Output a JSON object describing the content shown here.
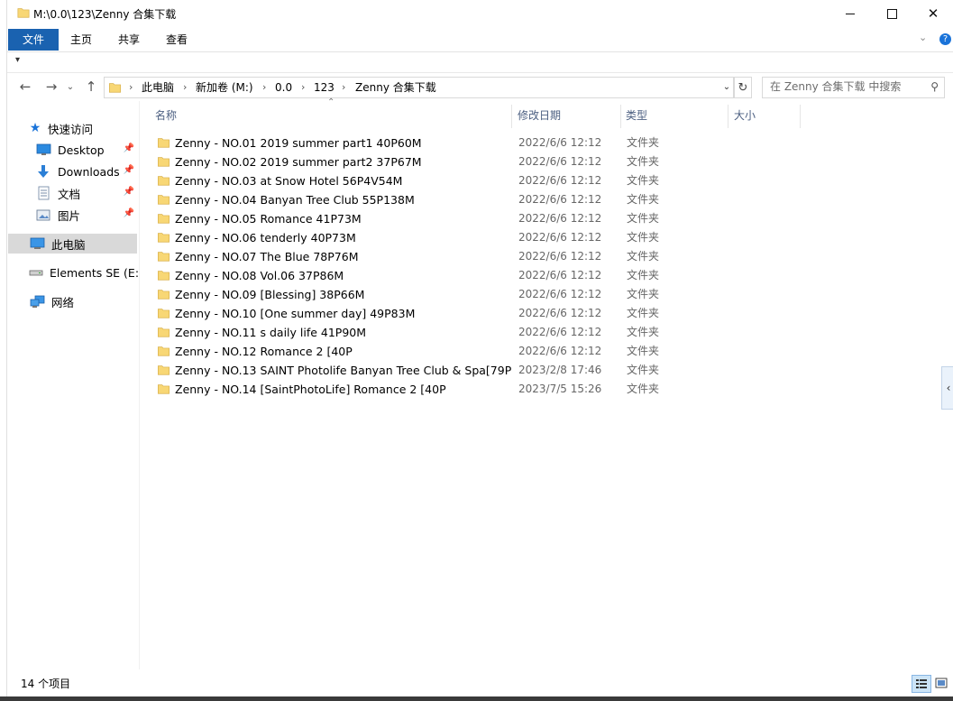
{
  "window": {
    "title": "M:\\0.0\\123\\Zenny 合集下载",
    "minimize_icon": "minimize-icon",
    "maximize_icon": "maximize-icon",
    "close_icon": "close-icon"
  },
  "ribbon": {
    "tabs": [
      "文件",
      "主页",
      "共享",
      "查看"
    ],
    "collapse_icon": "chevron-down-icon",
    "help_icon": "help-icon"
  },
  "address": {
    "crumbs": [
      "此电脑",
      "新加卷 (M:)",
      "0.0",
      "123",
      "Zenny 合集下载"
    ],
    "separator": "›"
  },
  "search": {
    "placeholder": "在 Zenny 合集下载 中搜索"
  },
  "sidebar": {
    "quick_access": "快速访问",
    "items": [
      {
        "label": "Desktop",
        "icon": "desktop-icon",
        "pinned": true
      },
      {
        "label": "Downloads",
        "icon": "download-icon",
        "pinned": true
      },
      {
        "label": "文档",
        "icon": "document-icon",
        "pinned": true
      },
      {
        "label": "图片",
        "icon": "picture-icon",
        "pinned": true
      }
    ],
    "this_pc": "此电脑",
    "drive": "Elements SE (E:)",
    "network": "网络"
  },
  "columns": {
    "name": "名称",
    "modified": "修改日期",
    "type": "类型",
    "size": "大小"
  },
  "files": [
    {
      "name": "Zenny - NO.01 2019 summer part1 40P60M",
      "date": "2022/6/6 12:12",
      "type": "文件夹"
    },
    {
      "name": "Zenny - NO.02 2019 summer part2 37P67M",
      "date": "2022/6/6 12:12",
      "type": "文件夹"
    },
    {
      "name": "Zenny - NO.03 at Snow Hotel 56P4V54M",
      "date": "2022/6/6 12:12",
      "type": "文件夹"
    },
    {
      "name": "Zenny - NO.04 Banyan Tree Club 55P138M",
      "date": "2022/6/6 12:12",
      "type": "文件夹"
    },
    {
      "name": "Zenny - NO.05 Romance 41P73M",
      "date": "2022/6/6 12:12",
      "type": "文件夹"
    },
    {
      "name": "Zenny - NO.06 tenderly 40P73M",
      "date": "2022/6/6 12:12",
      "type": "文件夹"
    },
    {
      "name": "Zenny - NO.07 The Blue 78P76M",
      "date": "2022/6/6 12:12",
      "type": "文件夹"
    },
    {
      "name": "Zenny - NO.08 Vol.06 37P86M",
      "date": "2022/6/6 12:12",
      "type": "文件夹"
    },
    {
      "name": "Zenny - NO.09 [Blessing] 38P66M",
      "date": "2022/6/6 12:12",
      "type": "文件夹"
    },
    {
      "name": "Zenny - NO.10 [One summer day] 49P83M",
      "date": "2022/6/6 12:12",
      "type": "文件夹"
    },
    {
      "name": "Zenny - NO.11 s daily life 41P90M",
      "date": "2022/6/6 12:12",
      "type": "文件夹"
    },
    {
      "name": "Zenny - NO.12 Romance 2 [40P",
      "date": "2022/6/6 12:12",
      "type": "文件夹"
    },
    {
      "name": "Zenny - NO.13 SAINT Photolife Banyan Tree Club & Spa[79P",
      "date": "2023/2/8 17:46",
      "type": "文件夹"
    },
    {
      "name": "Zenny - NO.14 [SaintPhotoLife] Romance 2 [40P",
      "date": "2023/7/5 15:26",
      "type": "文件夹"
    }
  ],
  "status": {
    "item_count": "14 个项目"
  },
  "colors": {
    "accent": "#1a62b0",
    "folder": "#f8d775",
    "selected_bg": "#d9d9d9",
    "column_header": "#4d6082"
  }
}
